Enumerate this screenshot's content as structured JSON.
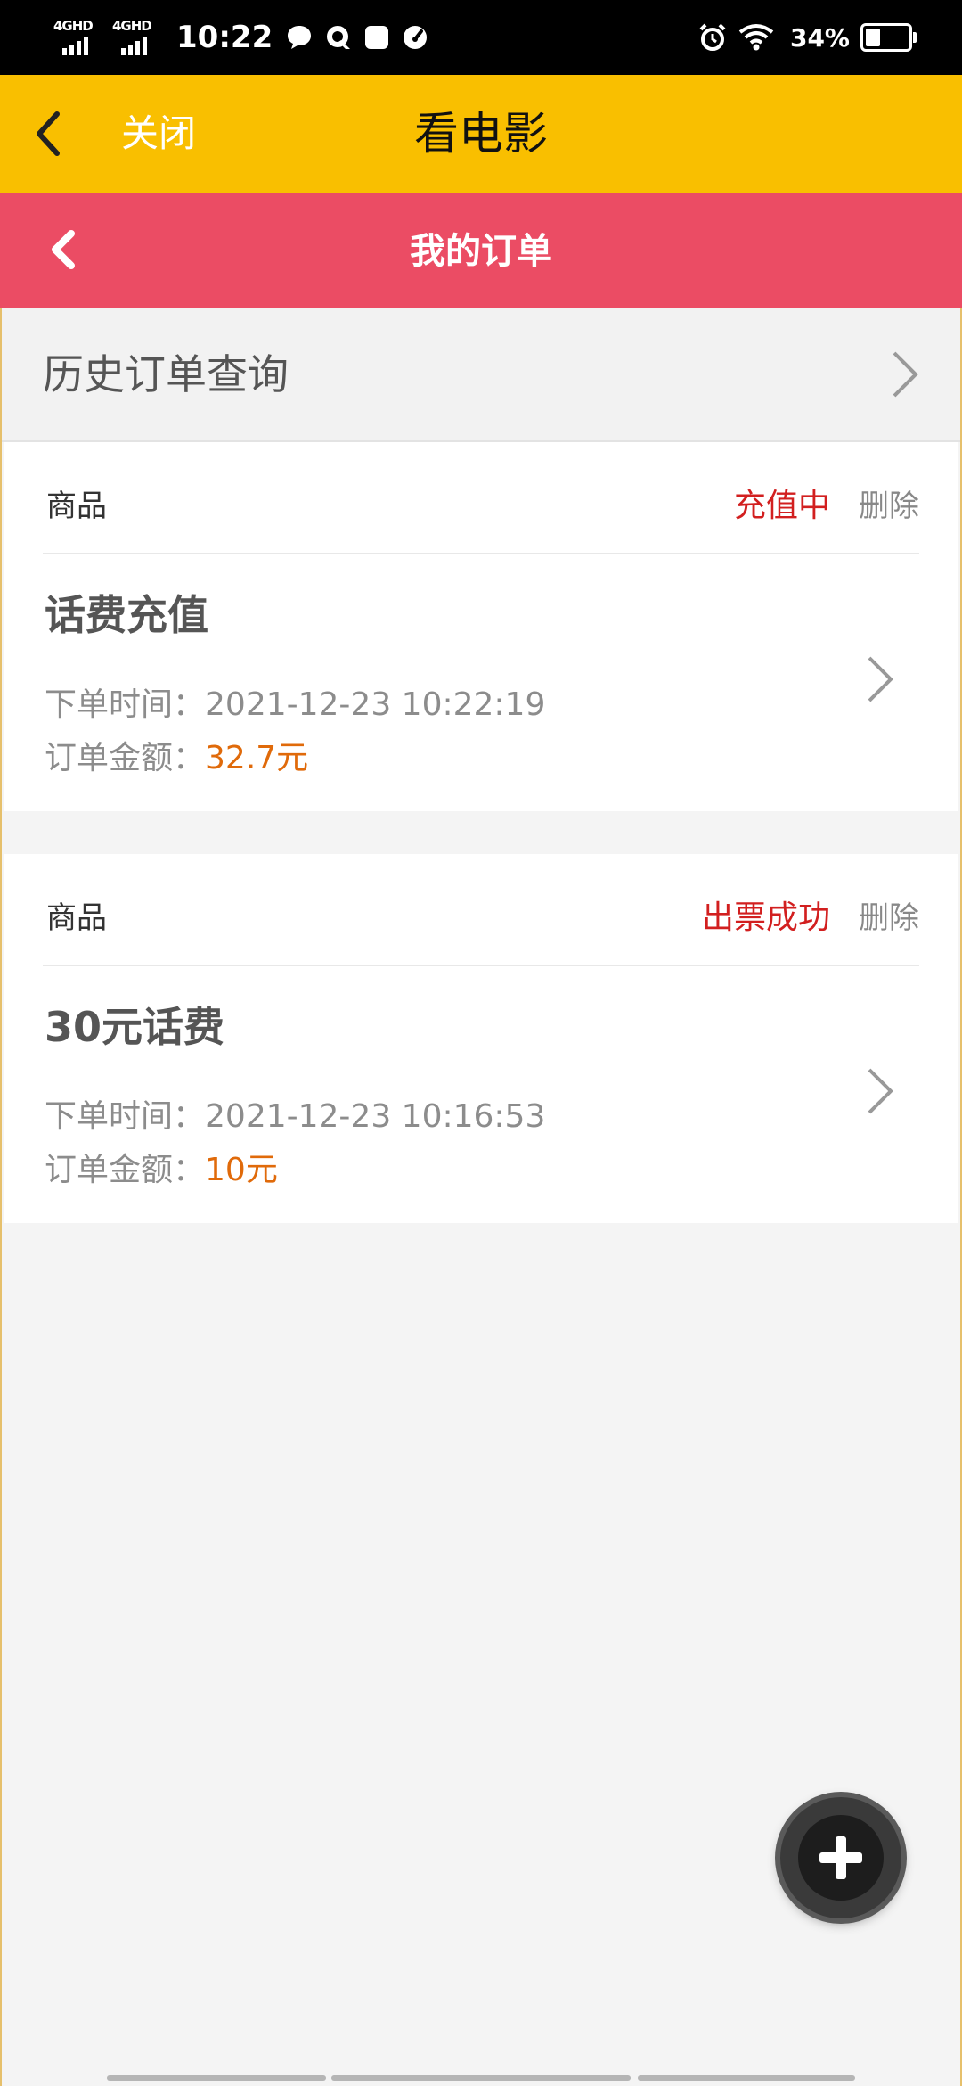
{
  "status_bar": {
    "signal_1": "4GHD",
    "signal_2": "4GHD",
    "time": "10:22",
    "battery": "34%",
    "battery_level": 0.34,
    "icons": [
      "message-icon",
      "q-icon",
      "app-square-icon",
      "speed-icon",
      "alarm-icon",
      "wifi-icon",
      "battery-icon"
    ]
  },
  "app_bar": {
    "close_label": "关闭",
    "title": "看电影"
  },
  "page_bar": {
    "title": "我的订单"
  },
  "history": {
    "label": "历史订单查询"
  },
  "orders": [
    {
      "kind": "商品",
      "status": "充值中",
      "delete_label": "删除",
      "name": "话费充值",
      "time_label": "下单时间：",
      "time": "2021-12-23 10:22:19",
      "amount_label": "订单金额：",
      "amount": "32.7元"
    },
    {
      "kind": "商品",
      "status": "出票成功",
      "delete_label": "删除",
      "name": "30元话费",
      "time_label": "下单时间：",
      "time": "2021-12-23 10:16:53",
      "amount_label": "订单金额：",
      "amount": "10元"
    }
  ],
  "colors": {
    "app_bar": "#f9bf00",
    "page_bar": "#eb4c64",
    "status_red": "#d21f1f",
    "price_orange": "#e06a0a"
  }
}
